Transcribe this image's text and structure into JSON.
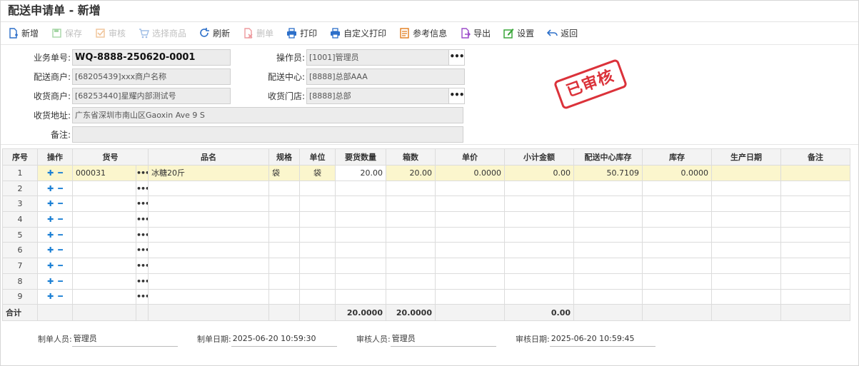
{
  "title": "配送申请单 - 新增",
  "toolbar": [
    {
      "label": "新增",
      "icon": "new-doc-icon",
      "color": "#2c6fc9",
      "disabled": false
    },
    {
      "label": "保存",
      "icon": "save-icon",
      "color": "#3aa63a",
      "disabled": true
    },
    {
      "label": "审核",
      "icon": "audit-check-icon",
      "color": "#e07b1a",
      "disabled": true
    },
    {
      "label": "选择商品",
      "icon": "cart-icon",
      "color": "#2c6fc9",
      "disabled": true
    },
    {
      "label": "刷新",
      "icon": "refresh-icon",
      "color": "#2c6fc9",
      "disabled": false
    },
    {
      "label": "删单",
      "icon": "delete-doc-icon",
      "color": "#d9212a",
      "disabled": true
    },
    {
      "label": "打印",
      "icon": "printer-icon",
      "color": "#2c6fc9",
      "disabled": false
    },
    {
      "label": "自定义打印",
      "icon": "printer-custom-icon",
      "color": "#2c6fc9",
      "disabled": false
    },
    {
      "label": "参考信息",
      "icon": "reference-icon",
      "color": "#e07b1a",
      "disabled": false
    },
    {
      "label": "导出",
      "icon": "export-icon",
      "color": "#9b4ac9",
      "disabled": false
    },
    {
      "label": "设置",
      "icon": "settings-edit-icon",
      "color": "#3aa63a",
      "disabled": false
    },
    {
      "label": "返回",
      "icon": "back-arrow-icon",
      "color": "#2c6fc9",
      "disabled": false
    }
  ],
  "form": {
    "order_no_label": "业务单号:",
    "order_no": "WQ-8888-250620-0001",
    "operator_label": "操作员:",
    "operator": "[1001]管理员",
    "merchant_label": "配送商户:",
    "merchant": "[68205439]xxx商户名称",
    "center_label": "配送中心:",
    "center": "[8888]总部AAA",
    "receiver_label": "收货商户:",
    "receiver": "[68253440]星耀内部测试号",
    "store_label": "收货门店:",
    "store": "[8888]总部",
    "address_label": "收货地址:",
    "address": "广东省深圳市南山区Gaoxin Ave 9 S",
    "remark_label": "备注:",
    "remark": ""
  },
  "stamp": "已审核",
  "table": {
    "headers": [
      "序号",
      "操作",
      "货号",
      "品名",
      "规格",
      "单位",
      "要货数量",
      "箱数",
      "单价",
      "小计金额",
      "配送中心库存",
      "库存",
      "生产日期",
      "备注"
    ],
    "rows": [
      {
        "seq": "1",
        "code": "000031",
        "name": "冰糖20斤",
        "spec": "袋",
        "unit": "袋",
        "qty": "20.00",
        "boxes": "20.00",
        "price": "0.0000",
        "subtotal": "0.00",
        "center_stock": "50.7109",
        "stock": "0.0000",
        "date": "",
        "remark": ""
      },
      {
        "seq": "2"
      },
      {
        "seq": "3"
      },
      {
        "seq": "4"
      },
      {
        "seq": "5"
      },
      {
        "seq": "6"
      },
      {
        "seq": "7"
      },
      {
        "seq": "8"
      },
      {
        "seq": "9"
      }
    ],
    "total": {
      "label": "合计",
      "qty": "20.0000",
      "boxes": "20.0000",
      "subtotal": "0.00"
    }
  },
  "footer": {
    "maker_label": "制单人员:",
    "maker": "管理员",
    "make_date_label": "制单日期:",
    "make_date": "2025-06-20 10:59:30",
    "auditor_label": "审核人员:",
    "auditor": "管理员",
    "audit_date_label": "审核日期:",
    "audit_date": "2025-06-20 10:59:45"
  }
}
